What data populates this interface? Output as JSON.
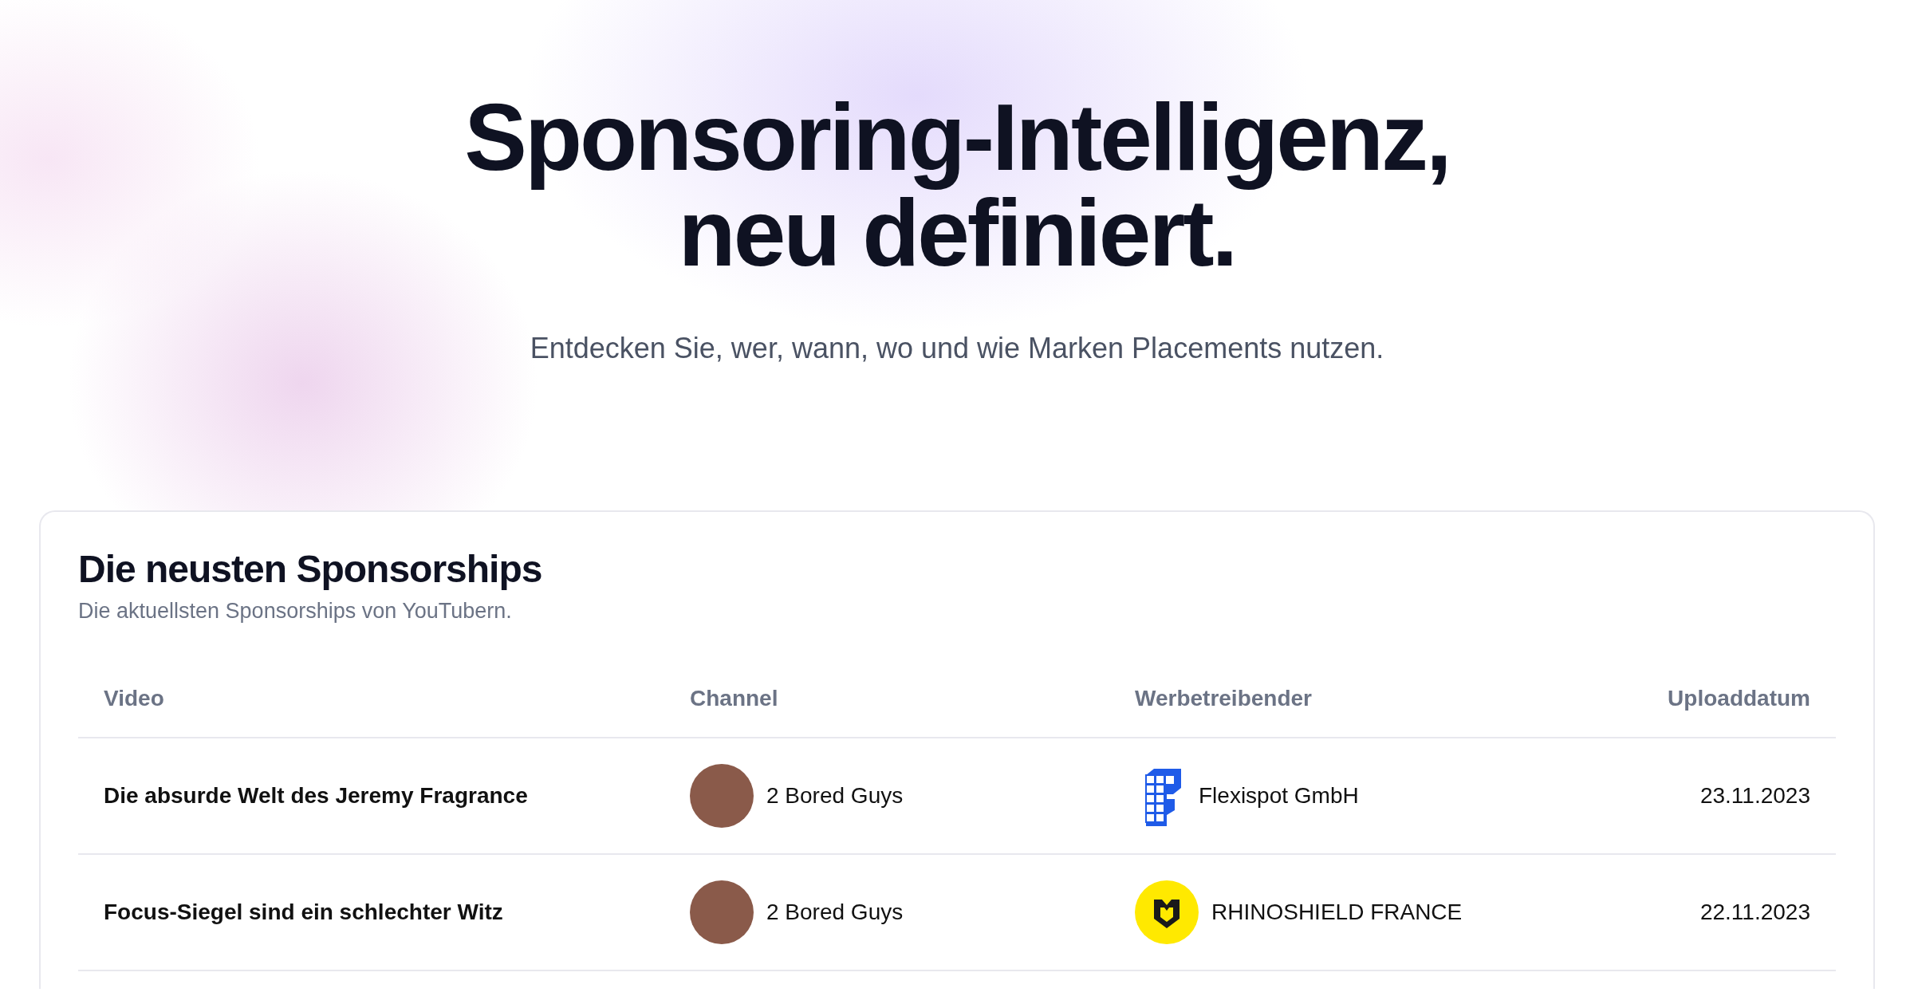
{
  "hero": {
    "title_lines": [
      "Sponsoring-Intelligenz,",
      "neu definiert."
    ],
    "subtitle": "Entdecken Sie, wer, wann, wo und wie Marken Placements nutzen."
  },
  "card": {
    "title": "Die neusten Sponsorships",
    "subtitle": "Die aktuellsten Sponsorships von YouTubern.",
    "columns": [
      "Video",
      "Channel",
      "Werbetreibender",
      "Uploaddatum"
    ],
    "rows": [
      {
        "video": "Die absurde Welt des Jeremy Fragrance",
        "channel": "2 Bored Guys",
        "advertiser": "Flexispot GmbH",
        "kind": "blocks",
        "upload_date": "23.11.2023"
      },
      {
        "video": "Focus-Siegel sind ein schlechter Witz",
        "channel": "2 Bored Guys",
        "advertiser": "RHINOSHIELD FRANCE",
        "kind": "shield",
        "upload_date": "22.11.2023"
      }
    ]
  }
}
